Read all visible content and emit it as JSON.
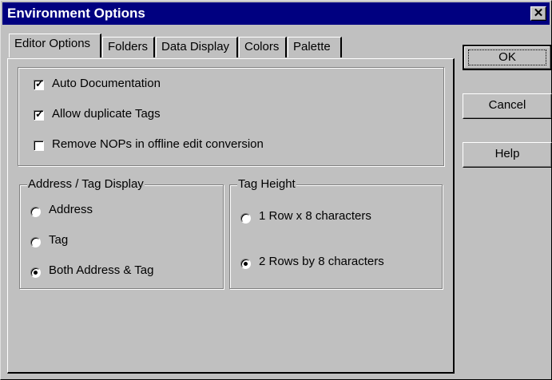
{
  "window": {
    "title": "Environment Options",
    "close_glyph": "✕"
  },
  "tabs": [
    {
      "label": "Editor Options",
      "active": true
    },
    {
      "label": "Folders",
      "active": false
    },
    {
      "label": "Data Display",
      "active": false
    },
    {
      "label": "Colors",
      "active": false
    },
    {
      "label": "Palette",
      "active": false
    }
  ],
  "options": [
    {
      "label": "Auto Documentation",
      "checked": true
    },
    {
      "label": "Allow duplicate Tags",
      "checked": true
    },
    {
      "label": "Remove NOPs in offline edit conversion",
      "checked": false
    }
  ],
  "address_tag_display": {
    "legend": "Address / Tag Display",
    "choices": [
      {
        "label": "Address",
        "selected": false
      },
      {
        "label": "Tag",
        "selected": false
      },
      {
        "label": "Both Address & Tag",
        "selected": true
      }
    ]
  },
  "tag_height": {
    "legend": "Tag Height",
    "choices": [
      {
        "label": "1 Row x 8 characters",
        "selected": false
      },
      {
        "label": "2 Rows by 8 characters",
        "selected": true
      }
    ]
  },
  "buttons": {
    "ok": "OK",
    "cancel": "Cancel",
    "help": "Help"
  },
  "colors": {
    "titlebar": "#000080",
    "face": "#c0c0c0"
  }
}
